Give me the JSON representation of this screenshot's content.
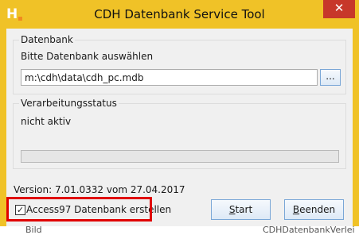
{
  "window": {
    "title": "CDH Datenbank Service Tool",
    "app_icon_letter": "H",
    "close_symbol": "✕",
    "frame_color": "#f0c227",
    "close_color": "#c7372a"
  },
  "database_group": {
    "legend": "Datenbank",
    "prompt": "Bitte Datenbank auswählen",
    "path_value": "m:\\cdh\\data\\cdh_pc.mdb",
    "browse_label": "..."
  },
  "status_group": {
    "legend": "Verarbeitungsstatus",
    "status_text": "nicht aktiv",
    "progress": 0
  },
  "version_text": "Version: 7.01.0332 vom 27.04.2017",
  "options": {
    "access97_label": "Access97 Datenbank erstellen",
    "access97_checked": true,
    "check_mark": "✓"
  },
  "buttons": {
    "start_mnemonic": "S",
    "start_rest": "tart",
    "exit_mnemonic": "B",
    "exit_rest": "eenden"
  },
  "background_items": [
    {
      "text": "Bild"
    },
    {
      "text": "CDHDatenbankVerlei"
    }
  ]
}
